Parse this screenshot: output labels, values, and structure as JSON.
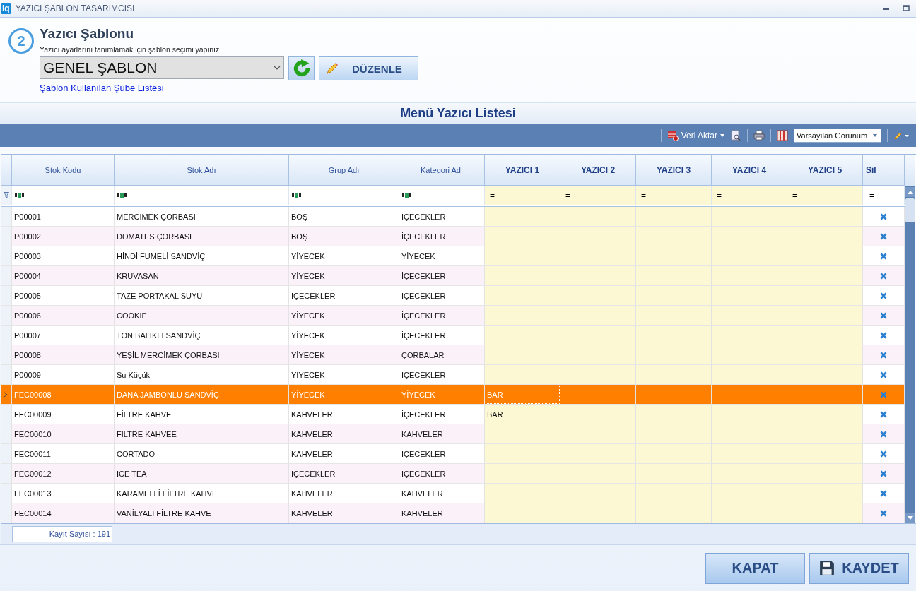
{
  "window": {
    "badge": "iq",
    "title": "YAZICI ŞABLON TASARIMCISI"
  },
  "header": {
    "step": "2",
    "title": "Yazıcı Şablonu",
    "subtitle": "Yazıcı ayarlarını tanımlamak için şablon seçimi yapınız",
    "template_select": {
      "value": "GENEL ŞABLON"
    },
    "edit_button": "DÜZENLE",
    "link": "Şablon Kullanılan Şube Listesi"
  },
  "section_title": "Menü Yazıcı Listesi",
  "toolbar": {
    "export_button": "Veri Aktar",
    "view_select": {
      "value": "Varsayılan Görünüm"
    }
  },
  "table": {
    "columns": [
      {
        "label": "Stok Kodu",
        "kind": "text"
      },
      {
        "label": "Stok Adı",
        "kind": "text"
      },
      {
        "label": "Grup Adı",
        "kind": "text"
      },
      {
        "label": "Kategori Adı",
        "kind": "text"
      },
      {
        "label": "YAZICI 1",
        "kind": "printer"
      },
      {
        "label": "YAZICI 2",
        "kind": "printer"
      },
      {
        "label": "YAZICI 3",
        "kind": "printer"
      },
      {
        "label": "YAZICI 4",
        "kind": "printer"
      },
      {
        "label": "YAZICI 5",
        "kind": "printer"
      },
      {
        "label": "Sil",
        "kind": "delete"
      }
    ],
    "filter_operator": "=",
    "rows": [
      {
        "code": "P00001",
        "name": "MERCİMEK ÇORBASI",
        "group": "BOŞ",
        "category": "İÇECEKLER",
        "selected": false
      },
      {
        "code": "P00002",
        "name": "DOMATES ÇORBASI",
        "group": "BOŞ",
        "category": "İÇECEKLER",
        "selected": false
      },
      {
        "code": "P00003",
        "name": "HİNDİ FÜMELİ SANDVİÇ",
        "group": "YİYECEK",
        "category": "YİYECEK",
        "selected": false
      },
      {
        "code": "P00004",
        "name": "KRUVASAN",
        "group": "YİYECEK",
        "category": "İÇECEKLER",
        "selected": false
      },
      {
        "code": "P00005",
        "name": "TAZE PORTAKAL SUYU",
        "group": "İÇECEKLER",
        "category": "İÇECEKLER",
        "selected": false
      },
      {
        "code": "P00006",
        "name": "COOKIE",
        "group": "YİYECEK",
        "category": "İÇECEKLER",
        "selected": false
      },
      {
        "code": "P00007",
        "name": "TON BALIKLI SANDVİÇ",
        "group": "YİYECEK",
        "category": "İÇECEKLER",
        "selected": false
      },
      {
        "code": "P00008",
        "name": "YEŞİL MERCİMEK ÇORBASI",
        "group": "YİYECEK",
        "category": "ÇORBALAR",
        "selected": false
      },
      {
        "code": "P00009",
        "name": "Su Küçük",
        "group": "YİYECEK",
        "category": "İÇECEKLER",
        "selected": false
      },
      {
        "code": "FEC00008",
        "name": "DANA JAMBONLU SANDVİÇ",
        "group": "YİYECEK",
        "category": "YİYECEK",
        "printers": [
          "BAR"
        ],
        "selected": true
      },
      {
        "code": "FEC00009",
        "name": "FİLTRE KAHVE",
        "group": "KAHVELER",
        "category": "İÇECEKLER",
        "printers": [
          "BAR"
        ],
        "selected": false
      },
      {
        "code": "FEC00010",
        "name": "FILTRE KAHVEE",
        "group": "KAHVELER",
        "category": "KAHVELER",
        "selected": false
      },
      {
        "code": "FEC00011",
        "name": "CORTADO",
        "group": "KAHVELER",
        "category": "İÇECEKLER",
        "selected": false
      },
      {
        "code": "FEC00012",
        "name": "ICE TEA",
        "group": "İÇECEKLER",
        "category": "İÇECEKLER",
        "selected": false
      },
      {
        "code": "FEC00013",
        "name": "KARAMELLİ FİLTRE KAHVE",
        "group": "KAHVELER",
        "category": "KAHVELER",
        "selected": false
      },
      {
        "code": "FEC00014",
        "name": "VANİLYALI FİLTRE KAHVE",
        "group": "KAHVELER",
        "category": "KAHVELER",
        "selected": false
      }
    ],
    "record_count": "Kayıt Sayısı : 191"
  },
  "buttons": [
    {
      "label": "KAPAT",
      "kind": "close"
    },
    {
      "label": "KAYDET",
      "kind": "save"
    }
  ]
}
